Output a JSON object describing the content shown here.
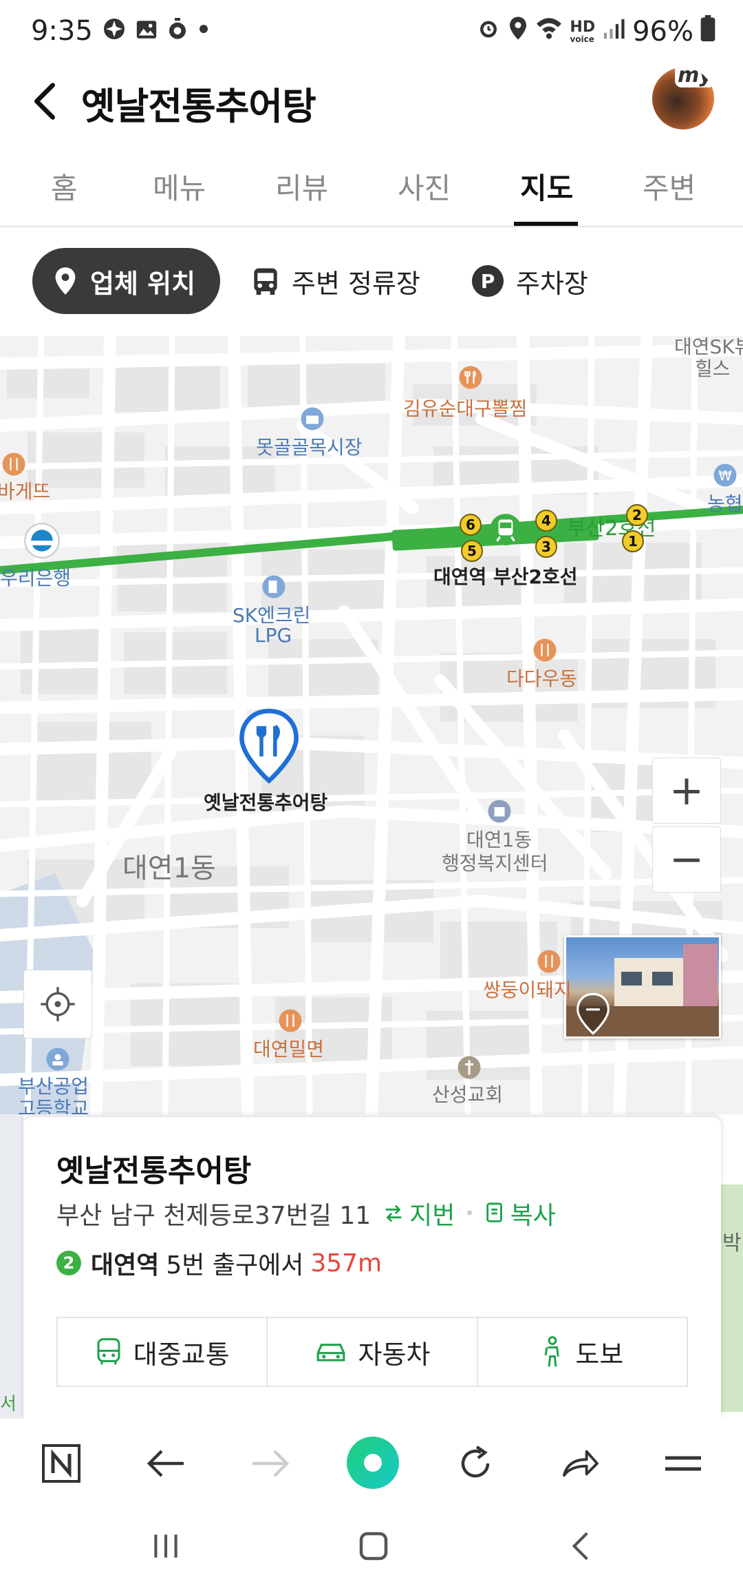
{
  "status": {
    "time": "9:35",
    "battery": "96%",
    "hd_text": "HD",
    "voice_text": "voice"
  },
  "header": {
    "title": "옛날전통추어탕",
    "avatar_badge": "my"
  },
  "tabs": [
    "홈",
    "메뉴",
    "리뷰",
    "사진",
    "지도",
    "주변"
  ],
  "active_tab": "지도",
  "chips": {
    "location": "업체 위치",
    "stops": "주변 정류장",
    "parking": "주차장",
    "parking_icon": "P"
  },
  "map": {
    "labels": {
      "top_right": "대연SK뷰",
      "top_right2": "힐스",
      "kimyusun": "김유순대구뽈찜",
      "market": "못골골목시장",
      "baguette": "바게뜨",
      "bank_right": "농협",
      "woori": "우리은행",
      "line": "부산2호선",
      "station": "대연역 부산2호선",
      "sk": "SK엔크린",
      "lpg": "LPG",
      "dadau": "다다우동",
      "shop": "옛날전통추어탕",
      "dong": "대연1동",
      "center1": "대연1동",
      "center2": "행정복지센터",
      "ssangdong": "쌍둥이돼지",
      "milmyeon": "대연밀면",
      "school1": "부산공업",
      "school2": "고등학교",
      "church": "산성교회",
      "right_edge": "박",
      "left_edge": "서리"
    },
    "exits": [
      "6",
      "5",
      "4",
      "3",
      "2",
      "1"
    ],
    "zoom_in": "+",
    "zoom_out": "−"
  },
  "card": {
    "name": "옛날전통추어탕",
    "address": "부산 남구 천제등로37번길 11",
    "jibun": "지번",
    "copy": "복사",
    "line_num": "2",
    "station": "대연역",
    "exit_text": "5번 출구에서",
    "distance": "357m",
    "modes": [
      "대중교통",
      "자동차",
      "도보"
    ]
  },
  "colors": {
    "accent": "#1ca349",
    "distance": "#e9443a",
    "pin": "#1f6fd6",
    "subway_line": "#3cb043"
  }
}
